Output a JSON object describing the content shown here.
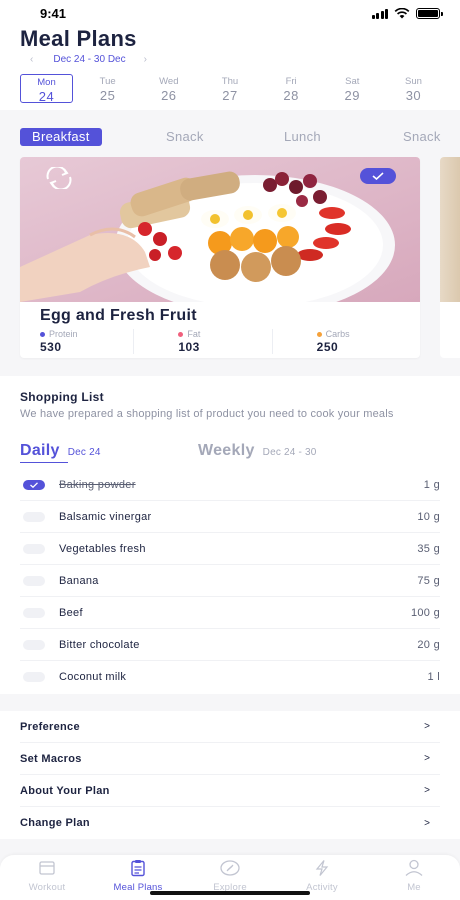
{
  "status_bar": {
    "time": "9:41"
  },
  "header": {
    "title": "Meal Plans",
    "date_range": "Dec 24 - 30 Dec",
    "prev_icon": "chevron-left-icon",
    "next_icon": "chevron-right-icon"
  },
  "week": [
    {
      "name": "Mon",
      "num": "24",
      "active": true
    },
    {
      "name": "Tue",
      "num": "25"
    },
    {
      "name": "Wed",
      "num": "26"
    },
    {
      "name": "Thu",
      "num": "27"
    },
    {
      "name": "Fri",
      "num": "28"
    },
    {
      "name": "Sat",
      "num": "29"
    },
    {
      "name": "Sun",
      "num": "30"
    }
  ],
  "meal_tabs": [
    "Breakfast",
    "Snack",
    "Lunch",
    "Snack"
  ],
  "meal_card": {
    "name": "Egg and Fresh Fruit",
    "macros": [
      {
        "label": "Protein",
        "value": "530",
        "color": "#5452d9"
      },
      {
        "label": "Fat",
        "value": "103",
        "color": "#f0607d"
      },
      {
        "label": "Carbs",
        "value": "250",
        "color": "#f5a13a"
      }
    ],
    "selected": true
  },
  "shopping": {
    "title": "Shopping List",
    "description": "We have prepared a shopping list of product you need to cook your meals",
    "tabs": [
      {
        "label": "Daily",
        "sub": "Dec 24"
      },
      {
        "label": "Weekly",
        "sub": "Dec 24 - 30"
      }
    ],
    "items": [
      {
        "name": "Baking powder",
        "qty": "1 g",
        "checked": true
      },
      {
        "name": "Balsamic vinergar",
        "qty": "10 g"
      },
      {
        "name": "Vegetables fresh",
        "qty": "35 g"
      },
      {
        "name": "Banana",
        "qty": "75 g"
      },
      {
        "name": "Beef",
        "qty": "100 g"
      },
      {
        "name": "Bitter chocolate",
        "qty": "20 g"
      },
      {
        "name": "Coconut milk",
        "qty": "1 l"
      }
    ]
  },
  "settings": {
    "items": [
      "Preference",
      "Set Macros",
      "About Your Plan",
      "Change Plan"
    ],
    "chevron": ">"
  },
  "tabbar": [
    {
      "label": "Workout",
      "icon": "calendar-icon"
    },
    {
      "label": "Meal Plans",
      "icon": "clipboard-icon",
      "active": true
    },
    {
      "label": "Explore",
      "icon": "compass-icon"
    },
    {
      "label": "Activity",
      "icon": "lightning-icon"
    },
    {
      "label": "Me",
      "icon": "person-icon"
    }
  ],
  "colors": {
    "accent": "#5452d9",
    "text": "#1d2340",
    "muted": "#a4a8b8"
  }
}
